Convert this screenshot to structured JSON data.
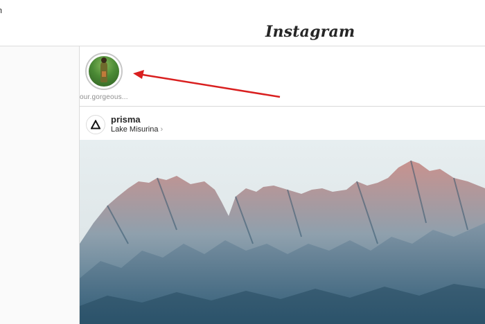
{
  "window": {
    "title": "m"
  },
  "header": {
    "logo_text": "Instagram"
  },
  "stories": [
    {
      "label": "our.gorgeous..."
    }
  ],
  "post": {
    "username": "prisma",
    "location": "Lake Misurina",
    "location_chevron": "›"
  },
  "colors": {
    "arrow": "#d91f1f",
    "border": "#dbdbdb",
    "sky": "#dfe8ea",
    "mountain_pink": "#c98a8a",
    "mountain_blue": "#4e7a94"
  },
  "icons": {
    "post_avatar": "prisma-triangle-icon",
    "location_chevron": "chevron-right-icon"
  }
}
